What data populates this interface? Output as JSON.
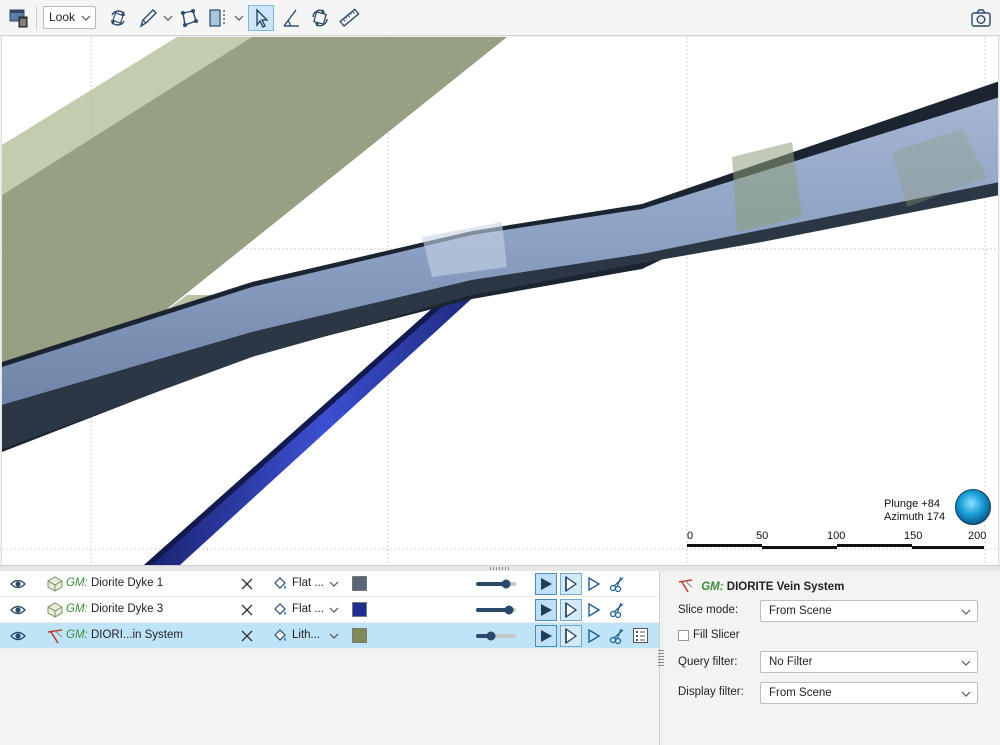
{
  "toolbar": {
    "view_mode": "Look",
    "buttons": [
      {
        "icon": "delete-scene-icon"
      },
      {
        "icon": "rotate-view-icon"
      },
      {
        "icon": "draw-pencil-icon"
      },
      {
        "icon": "move-points-icon"
      },
      {
        "icon": "slicer-icon"
      },
      {
        "icon": "select-pointer-icon",
        "active": true
      },
      {
        "icon": "measure-angle-icon"
      },
      {
        "icon": "reset-view-icon"
      },
      {
        "icon": "ruler-icon"
      },
      {
        "icon": "camera-icon"
      }
    ]
  },
  "scene": {
    "plunge_text": "Plunge +84",
    "azimuth_text": "Azimuth 174",
    "scale_ticks": [
      "0",
      "50",
      "100",
      "150",
      "200"
    ],
    "colors": {
      "vein": "#8a9fc2",
      "vein_edge": "#1b2430",
      "dyke_olive": "#8d9677",
      "dyke_olive_light": "#b9c39f",
      "dyke_blue": "#2f3fb0"
    }
  },
  "layers": [
    {
      "prefix": "GM:",
      "name": "Diorite Dyke 1",
      "shading": "Flat ...",
      "swatch": "#5a6478",
      "opacity": 0.85,
      "selected": false
    },
    {
      "prefix": "GM:",
      "name": "Diorite Dyke 3",
      "shading": "Flat ...",
      "swatch": "#1f2f8f",
      "opacity": 0.95,
      "selected": false
    },
    {
      "prefix": "GM:",
      "name": "DIORI...in System",
      "shading": "Lith...",
      "swatch": "#7f8a57",
      "opacity": 0.35,
      "selected": true
    }
  ],
  "properties": {
    "prefix": "GM:",
    "title": "DIORITE Vein System",
    "slice_mode_label": "Slice mode:",
    "slice_mode_value": "From Scene",
    "fill_slicer_label": "Fill Slicer",
    "query_filter_label": "Query filter:",
    "query_filter_value": "No Filter",
    "display_filter_label": "Display filter:",
    "display_filter_value": "From Scene"
  }
}
